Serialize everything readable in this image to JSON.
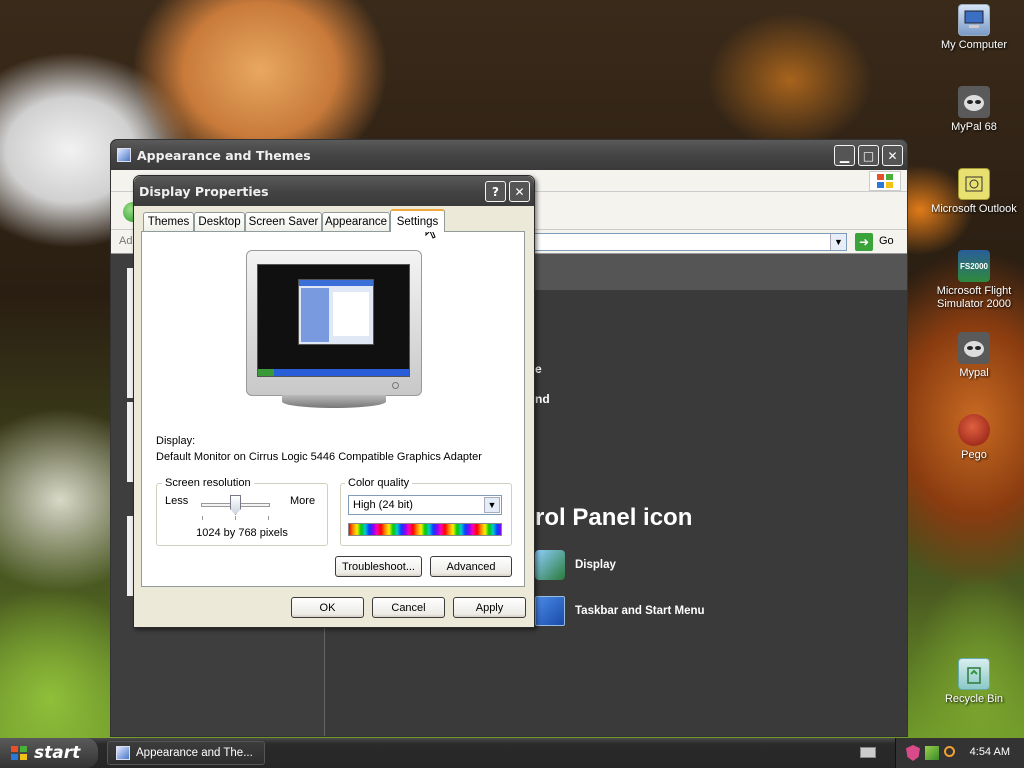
{
  "desktop": {
    "icons": [
      {
        "label": "My Computer",
        "icon": "computer-icon"
      },
      {
        "label": "MyPal 68",
        "icon": "raccoon-shortcut-icon"
      },
      {
        "label": "Microsoft Outlook",
        "icon": "outlook-icon"
      },
      {
        "label": "Microsoft Flight Simulator 2000",
        "icon": "flight-simulator-icon",
        "badge": "FS2000"
      },
      {
        "label": "Mypal",
        "icon": "raccoon-shortcut-icon"
      },
      {
        "label": "Pego",
        "icon": "pego-shortcut-icon"
      },
      {
        "label": "Recycle Bin",
        "icon": "recycle-bin-icon"
      }
    ]
  },
  "control_panel": {
    "title": "Appearance and Themes",
    "address_partial": "Ad",
    "go_label": "Go",
    "heading_partial": "rol Panel icon",
    "text_fragment_1": "e",
    "text_fragment_2": "nd",
    "icons": [
      {
        "label": "Display"
      },
      {
        "label": "Taskbar and Start Menu"
      }
    ]
  },
  "dialog": {
    "title": "Display Properties",
    "help_glyph": "?",
    "close_glyph": "✕",
    "tabs": [
      "Themes",
      "Desktop",
      "Screen Saver",
      "Appearance",
      "Settings"
    ],
    "active_tab": "Settings",
    "display_label": "Display:",
    "display_value": "Default Monitor on Cirrus Logic 5446 Compatible Graphics Adapter",
    "resolution": {
      "title": "Screen resolution",
      "less": "Less",
      "more": "More",
      "value": "1024 by 768 pixels",
      "slider_level": 0.5
    },
    "color": {
      "title": "Color quality",
      "selected": "High (24 bit)"
    },
    "troubleshoot_label": "Troubleshoot...",
    "advanced_label": "Advanced",
    "ok_label": "OK",
    "cancel_label": "Cancel",
    "apply_label": "Apply"
  },
  "taskbar": {
    "start_label": "start",
    "task_label": "Appearance and The...",
    "clock": "4:54 AM"
  },
  "colors": {
    "dialog_bg": "#ece9d8",
    "title_bar": "#4a4a4a",
    "taskbar": "#2c2c2c",
    "start_button": "#3a3a3a"
  }
}
